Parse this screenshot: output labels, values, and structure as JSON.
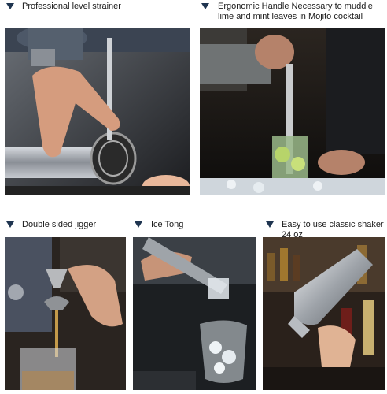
{
  "panels": [
    {
      "icon": "triangle-down-icon",
      "caption": "Professional level strainer",
      "photo": "strainer-photo"
    },
    {
      "icon": "triangle-down-icon",
      "caption": "Ergonomic Handle Necessary to muddle lime and mint leaves in Mojito cocktail",
      "photo": "muddler-photo"
    },
    {
      "icon": "triangle-down-icon",
      "caption": "Double sided jigger",
      "photo": "jigger-photo"
    },
    {
      "icon": "triangle-down-icon",
      "caption": "Ice Tong",
      "photo": "ice-tong-photo"
    },
    {
      "icon": "triangle-down-icon",
      "caption": "Easy to use classic shaker 24 oz",
      "photo": "shaker-photo"
    }
  ],
  "colors": {
    "accent": "#1f3550"
  }
}
